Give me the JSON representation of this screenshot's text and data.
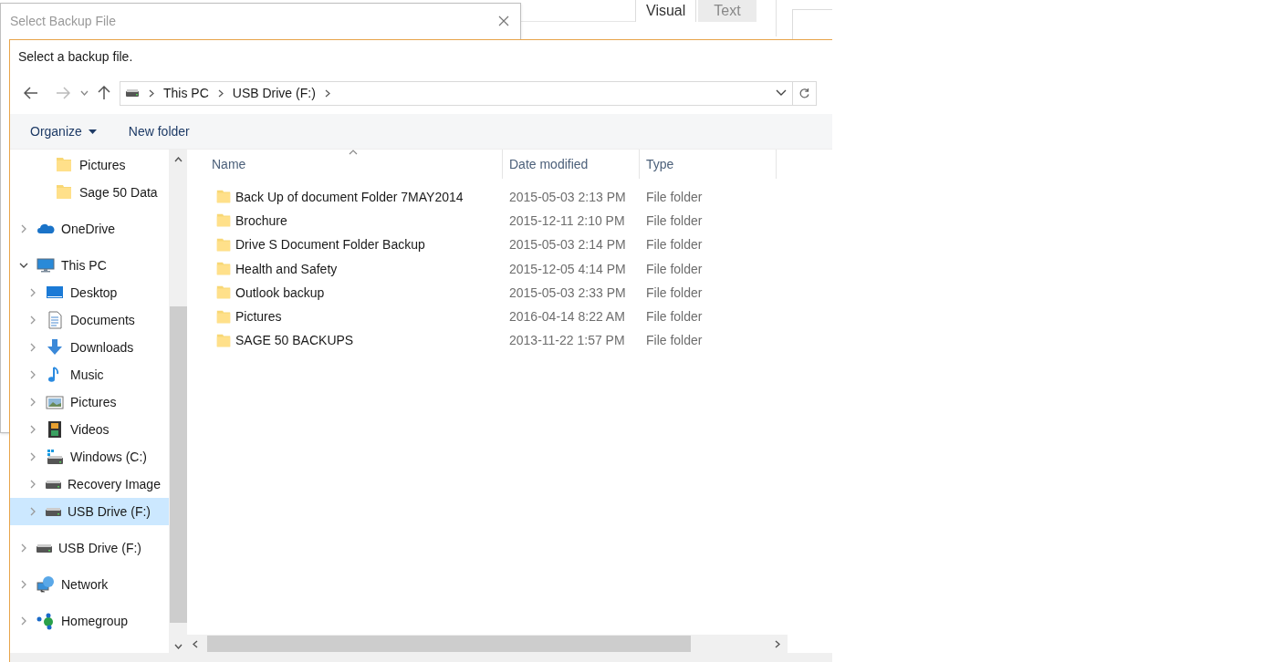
{
  "back_window": {
    "title": "Select Backup File"
  },
  "editor_tabs": [
    {
      "label": "Visual",
      "selected": true
    },
    {
      "label": "Text",
      "selected": false
    }
  ],
  "dialog": {
    "prompt": "Select a backup file."
  },
  "address_bar": {
    "path": [
      "This PC",
      "USB Drive (F:)"
    ]
  },
  "toolbar": {
    "organize": "Organize",
    "new_folder": "New folder"
  },
  "quick_access_items": [
    {
      "label": "Pictures",
      "kind": "folder",
      "selected": false
    },
    {
      "label": "Sage 50 Data",
      "kind": "folder",
      "selected": false
    }
  ],
  "nav_tree": [
    {
      "label": "OneDrive",
      "kind": "cloud",
      "expanded": false,
      "selected": false
    },
    {
      "label": "This PC",
      "kind": "pc",
      "expanded": true,
      "selected": false,
      "children": [
        {
          "label": "Desktop",
          "kind": "desktop",
          "expanded": false,
          "selected": false
        },
        {
          "label": "Documents",
          "kind": "documents",
          "expanded": false,
          "selected": false
        },
        {
          "label": "Downloads",
          "kind": "downloads",
          "expanded": false,
          "selected": false
        },
        {
          "label": "Music",
          "kind": "music",
          "expanded": false,
          "selected": false
        },
        {
          "label": "Pictures",
          "kind": "pictures",
          "expanded": false,
          "selected": false
        },
        {
          "label": "Videos",
          "kind": "videos",
          "expanded": false,
          "selected": false
        },
        {
          "label": "Windows (C:)",
          "kind": "windows-drive",
          "expanded": false,
          "selected": false
        },
        {
          "label": "Recovery Image",
          "kind": "drive",
          "expanded": false,
          "selected": false
        },
        {
          "label": "USB Drive (F:)",
          "kind": "drive",
          "expanded": false,
          "selected": true
        }
      ]
    },
    {
      "label": "USB Drive (F:)",
      "kind": "drive",
      "expanded": false,
      "selected": false
    },
    {
      "label": "Network",
      "kind": "network",
      "expanded": false,
      "selected": false
    },
    {
      "label": "Homegroup",
      "kind": "homegroup",
      "expanded": false,
      "selected": false
    }
  ],
  "table": {
    "columns": [
      "Name",
      "Date modified",
      "Type"
    ],
    "rows": [
      {
        "name": "Back Up of document Folder 7MAY2014",
        "date": "2015-05-03 2:13 PM",
        "type": "File folder",
        "selected": false
      },
      {
        "name": "Brochure",
        "date": "2015-12-11 2:10 PM",
        "type": "File folder",
        "selected": false
      },
      {
        "name": "Drive S Document Folder Backup",
        "date": "2015-05-03 2:14 PM",
        "type": "File folder",
        "selected": false
      },
      {
        "name": "Health and Safety",
        "date": "2015-12-05 4:14 PM",
        "type": "File folder",
        "selected": false
      },
      {
        "name": "Outlook backup",
        "date": "2015-05-03 2:33 PM",
        "type": "File folder",
        "selected": false
      },
      {
        "name": "Pictures",
        "date": "2016-04-14 8:22 AM",
        "type": "File folder",
        "selected": false
      },
      {
        "name": "SAGE 50 BACKUPS",
        "date": "2013-11-22 1:57 PM",
        "type": "File folder",
        "selected": false
      }
    ]
  }
}
